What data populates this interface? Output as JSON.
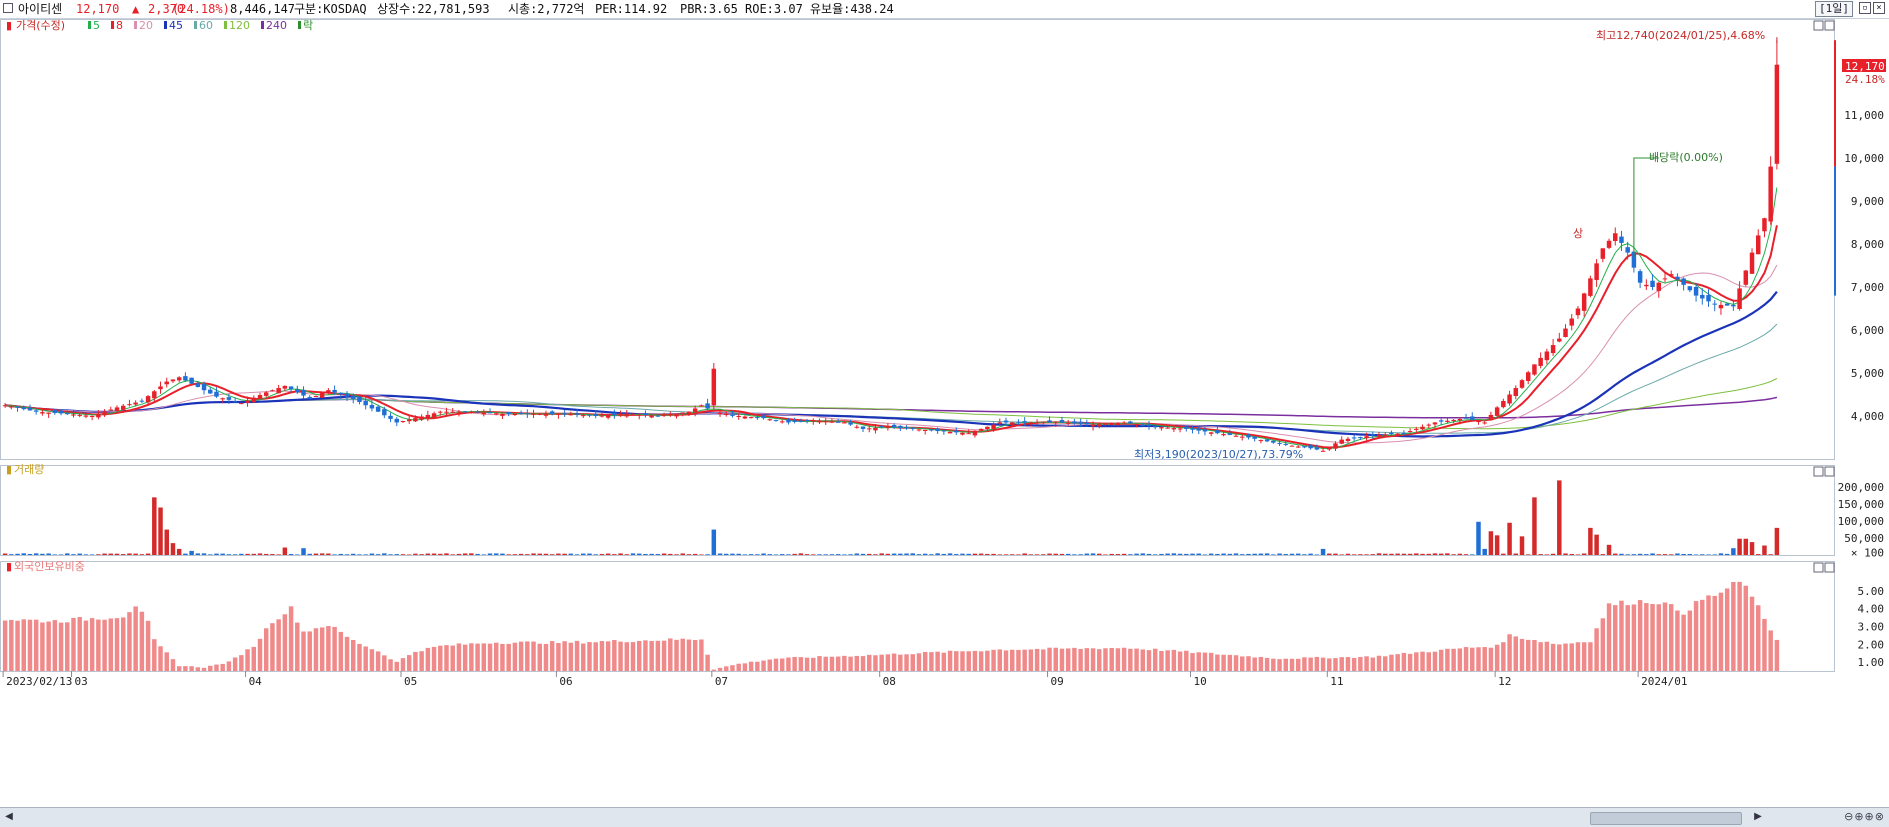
{
  "header": {
    "stock_name": "아이티센",
    "price": "12,170",
    "change_arrow": "▲",
    "change": "2,370",
    "change_pct": "(24.18%)",
    "volume": "8,446,147",
    "market": "구분:KOSDAQ",
    "shares": "상장수:22,781,593",
    "market_cap": "시총:2,772억",
    "per": "PER:114.92",
    "pbr": "PBR:3.65",
    "roe": "ROE:3.07",
    "float_ratio": "유보율:438.24",
    "period": "[1일]",
    "colors": {
      "up": "#e8202a",
      "down": "#1f6fd6",
      "text": "#111111"
    }
  },
  "legend": {
    "price": "가격(수정)",
    "items": [
      {
        "label": "5",
        "color": "#22b14c"
      },
      {
        "label": "8",
        "color": "#e8202a"
      },
      {
        "label": "20",
        "color": "#d98fb0"
      },
      {
        "label": "45",
        "color": "#1a33b8"
      },
      {
        "label": "60",
        "color": "#6aa9a8"
      },
      {
        "label": "120",
        "color": "#7fbf3f"
      },
      {
        "label": "240",
        "color": "#7b2f9e"
      },
      {
        "label": "락",
        "color": "#2d8f2d"
      }
    ]
  },
  "panels": {
    "volume_title": "거래량",
    "foreign_title": "외국인보유비중"
  },
  "annotations": {
    "high": "최고12,740(2024/01/25),4.68%",
    "low": "최저3,190(2023/10/27),73.79%",
    "dividend": "배당락(0.00%)",
    "upper_limit": "상",
    "current_price": "12,170",
    "current_pct": "24.18%"
  },
  "chart_data": [
    {
      "type": "candlestick",
      "title": "가격(수정)",
      "ylim": [
        3000,
        13000
      ],
      "y_ticks": [
        "4,000",
        "5,000",
        "6,000",
        "7,000",
        "8,000",
        "9,000",
        "10,000",
        "11,000"
      ],
      "x_ticks": [
        "2023/02/13",
        "03",
        "04",
        "05",
        "06",
        "07",
        "08",
        "09",
        "10",
        "11",
        "12",
        "2024/01"
      ],
      "x_tick_index": [
        0,
        11,
        39,
        64,
        89,
        114,
        141,
        168,
        191,
        213,
        240,
        263
      ],
      "n_days": 286,
      "keypoints": [
        [
          0,
          4250
        ],
        [
          5,
          4100
        ],
        [
          10,
          4050
        ],
        [
          14,
          4000
        ],
        [
          18,
          4200
        ],
        [
          22,
          4350
        ],
        [
          26,
          4800
        ],
        [
          28,
          4900
        ],
        [
          30,
          4750
        ],
        [
          34,
          4450
        ],
        [
          38,
          4300
        ],
        [
          42,
          4550
        ],
        [
          45,
          4700
        ],
        [
          49,
          4400
        ],
        [
          52,
          4600
        ],
        [
          56,
          4400
        ],
        [
          60,
          4100
        ],
        [
          63,
          3850
        ],
        [
          66,
          3950
        ],
        [
          70,
          4100
        ],
        [
          75,
          4100
        ],
        [
          80,
          4050
        ],
        [
          85,
          4050
        ],
        [
          90,
          4050
        ],
        [
          95,
          4000
        ],
        [
          100,
          4050
        ],
        [
          105,
          4000
        ],
        [
          110,
          4100
        ],
        [
          112,
          4250
        ],
        [
          114,
          4100
        ],
        [
          118,
          4000
        ],
        [
          122,
          3950
        ],
        [
          126,
          3850
        ],
        [
          130,
          3900
        ],
        [
          135,
          3850
        ],
        [
          138,
          3700
        ],
        [
          142,
          3750
        ],
        [
          146,
          3700
        ],
        [
          150,
          3650
        ],
        [
          155,
          3600
        ],
        [
          160,
          3850
        ],
        [
          165,
          3850
        ],
        [
          170,
          3850
        ],
        [
          175,
          3800
        ],
        [
          180,
          3850
        ],
        [
          185,
          3750
        ],
        [
          190,
          3700
        ],
        [
          195,
          3600
        ],
        [
          200,
          3500
        ],
        [
          205,
          3350
        ],
        [
          210,
          3250
        ],
        [
          212,
          3190
        ],
        [
          215,
          3450
        ],
        [
          220,
          3550
        ],
        [
          225,
          3600
        ],
        [
          230,
          3850
        ],
        [
          235,
          3950
        ],
        [
          238,
          3850
        ],
        [
          240,
          4200
        ],
        [
          243,
          4650
        ],
        [
          246,
          5200
        ],
        [
          250,
          5800
        ],
        [
          253,
          6500
        ],
        [
          255,
          7200
        ],
        [
          257,
          7900
        ],
        [
          259,
          8250
        ],
        [
          261,
          7800
        ],
        [
          263,
          7100
        ],
        [
          265,
          7000
        ],
        [
          268,
          7300
        ],
        [
          272,
          6800
        ],
        [
          275,
          6600
        ],
        [
          278,
          6550
        ],
        [
          281,
          7800
        ],
        [
          283,
          8600
        ],
        [
          284,
          9800
        ],
        [
          285,
          12170
        ]
      ],
      "spike": {
        "index": 114,
        "high": 5150,
        "open": 4250,
        "close": 5100
      },
      "high_point": {
        "index": 285,
        "value": 12740
      },
      "low_point": {
        "index": 212,
        "value": 3190
      }
    },
    {
      "type": "bar",
      "title": "거래량",
      "ylim": [
        0,
        230000
      ],
      "y_ticks": [
        "200,000",
        "150,000",
        "100,000",
        "50,000"
      ],
      "y_unit": "× 100",
      "spikes": [
        [
          24,
          170000
        ],
        [
          25,
          140000
        ],
        [
          26,
          75000
        ],
        [
          27,
          35000
        ],
        [
          28,
          18000
        ],
        [
          30,
          12000
        ],
        [
          45,
          22000
        ],
        [
          48,
          20000
        ],
        [
          114,
          75000
        ],
        [
          212,
          18000
        ],
        [
          237,
          98000
        ],
        [
          238,
          18000
        ],
        [
          239,
          70000
        ],
        [
          240,
          58000
        ],
        [
          242,
          95000
        ],
        [
          244,
          55000
        ],
        [
          246,
          170000
        ],
        [
          250,
          220000
        ],
        [
          255,
          80000
        ],
        [
          256,
          60000
        ],
        [
          258,
          30000
        ],
        [
          278,
          20000
        ],
        [
          279,
          48000
        ],
        [
          280,
          48000
        ],
        [
          281,
          38000
        ],
        [
          283,
          28000
        ],
        [
          285,
          80000
        ]
      ]
    },
    {
      "type": "bar",
      "title": "외국인보유비중",
      "ylim": [
        0.5,
        6.0
      ],
      "y_ticks": [
        "5.00",
        "4.00",
        "3.00",
        "2.00",
        "1.00"
      ],
      "keypoints": [
        [
          0,
          3.4
        ],
        [
          8,
          3.3
        ],
        [
          16,
          3.5
        ],
        [
          19,
          3.6
        ],
        [
          21,
          4.2
        ],
        [
          23,
          3.2
        ],
        [
          24,
          2.2
        ],
        [
          26,
          1.5
        ],
        [
          28,
          0.8
        ],
        [
          32,
          0.7
        ],
        [
          36,
          1.0
        ],
        [
          40,
          1.9
        ],
        [
          43,
          3.3
        ],
        [
          46,
          4.0
        ],
        [
          48,
          2.7
        ],
        [
          52,
          3.1
        ],
        [
          56,
          2.2
        ],
        [
          60,
          1.6
        ],
        [
          63,
          1.0
        ],
        [
          66,
          1.6
        ],
        [
          70,
          1.9
        ],
        [
          78,
          2.1
        ],
        [
          90,
          2.1
        ],
        [
          112,
          2.3
        ],
        [
          114,
          0.6
        ],
        [
          118,
          0.9
        ],
        [
          124,
          1.2
        ],
        [
          140,
          1.4
        ],
        [
          160,
          1.7
        ],
        [
          180,
          1.8
        ],
        [
          185,
          1.7
        ],
        [
          205,
          1.2
        ],
        [
          220,
          1.3
        ],
        [
          235,
          1.8
        ],
        [
          240,
          1.9
        ],
        [
          242,
          2.5
        ],
        [
          245,
          2.3
        ],
        [
          250,
          2.0
        ],
        [
          255,
          2.2
        ],
        [
          258,
          4.2
        ],
        [
          262,
          4.4
        ],
        [
          266,
          4.4
        ],
        [
          270,
          3.8
        ],
        [
          273,
          4.5
        ],
        [
          276,
          4.9
        ],
        [
          279,
          5.5
        ],
        [
          281,
          4.8
        ],
        [
          283,
          3.3
        ],
        [
          285,
          2.3
        ]
      ]
    }
  ]
}
